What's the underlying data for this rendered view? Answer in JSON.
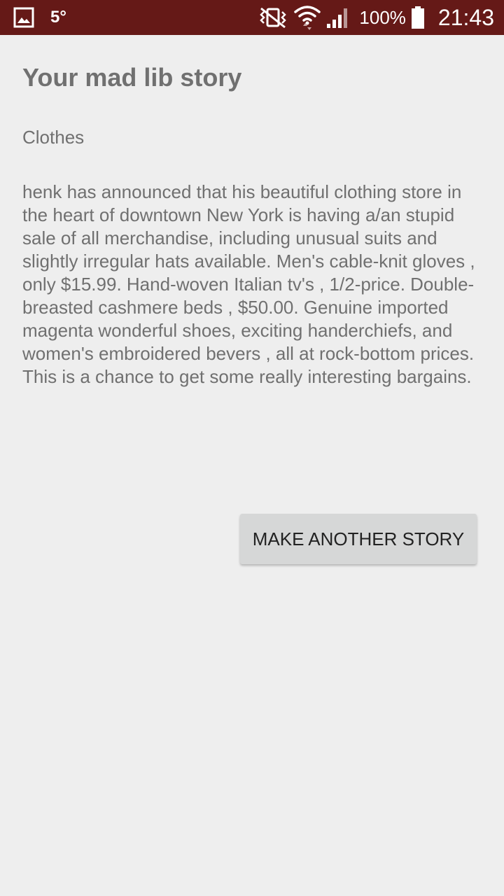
{
  "status_bar": {
    "weather": "5°",
    "battery": "100%",
    "time": "21:43",
    "icons": [
      "gallery-icon",
      "vibrate-icon",
      "wifi-icon",
      "signal-icon",
      "battery-icon"
    ]
  },
  "screen": {
    "title": "Your mad lib story",
    "category": "Clothes",
    "story": " henk has announced that his beautiful  clothing store in the heart of downtown New York  is having a/an stupid  sale of all merchandise, including unusual  suits and slightly irregular hats available. Men's cable-knit gloves  , only $15.99. Hand-woven Italian tv's  , 1/2-price. Double- breasted cashmere beds , $50.00. Genuine imported magenta wonderful  shoes, exciting  handerchiefs, and women's embroidered bevers , all at rock-bottom prices. This is a chance to get some really interesting  bargains.",
    "button_label": "MAKE ANOTHER STORY"
  },
  "colors": {
    "status_bar": "#651917",
    "background": "#eeeeee",
    "text": "#707070",
    "button": "#d6d7d7"
  }
}
